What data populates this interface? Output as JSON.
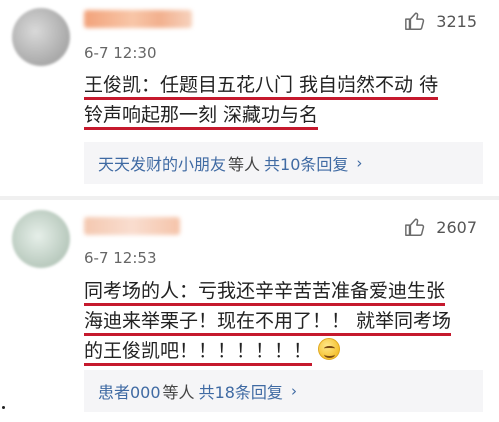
{
  "comments": [
    {
      "time": "6-7 12:30",
      "likes": "3215",
      "lines": [
        "王俊凯：任题目五花八门 我自岿然不动 待",
        "铃声响起那一刻 深藏功与名"
      ],
      "reply_user": "天天发财的小朋友",
      "reply_suffix": "等人",
      "reply_count": "共10条回复",
      "reply_chevron": "›"
    },
    {
      "time": "6-7 12:53",
      "likes": "2607",
      "lines": [
        "同考场的人：亏我还辛辛苦苦准备爱迪生张",
        "海迪来举栗子！现在不用了！！ 就举同考场",
        "的王俊凯吧！！！！！！！"
      ],
      "reply_user": "患者000",
      "reply_suffix": "等人",
      "reply_count": "共18条回复",
      "reply_chevron": "›"
    }
  ],
  "icons": {
    "like": "thumbs-up-icon",
    "emoji": "smile-emoji-icon",
    "chevron": "chevron-right-icon"
  },
  "colors": {
    "underline": "#c5192d",
    "link": "#3f6aa3",
    "reply_bg": "#f5f5f7"
  }
}
